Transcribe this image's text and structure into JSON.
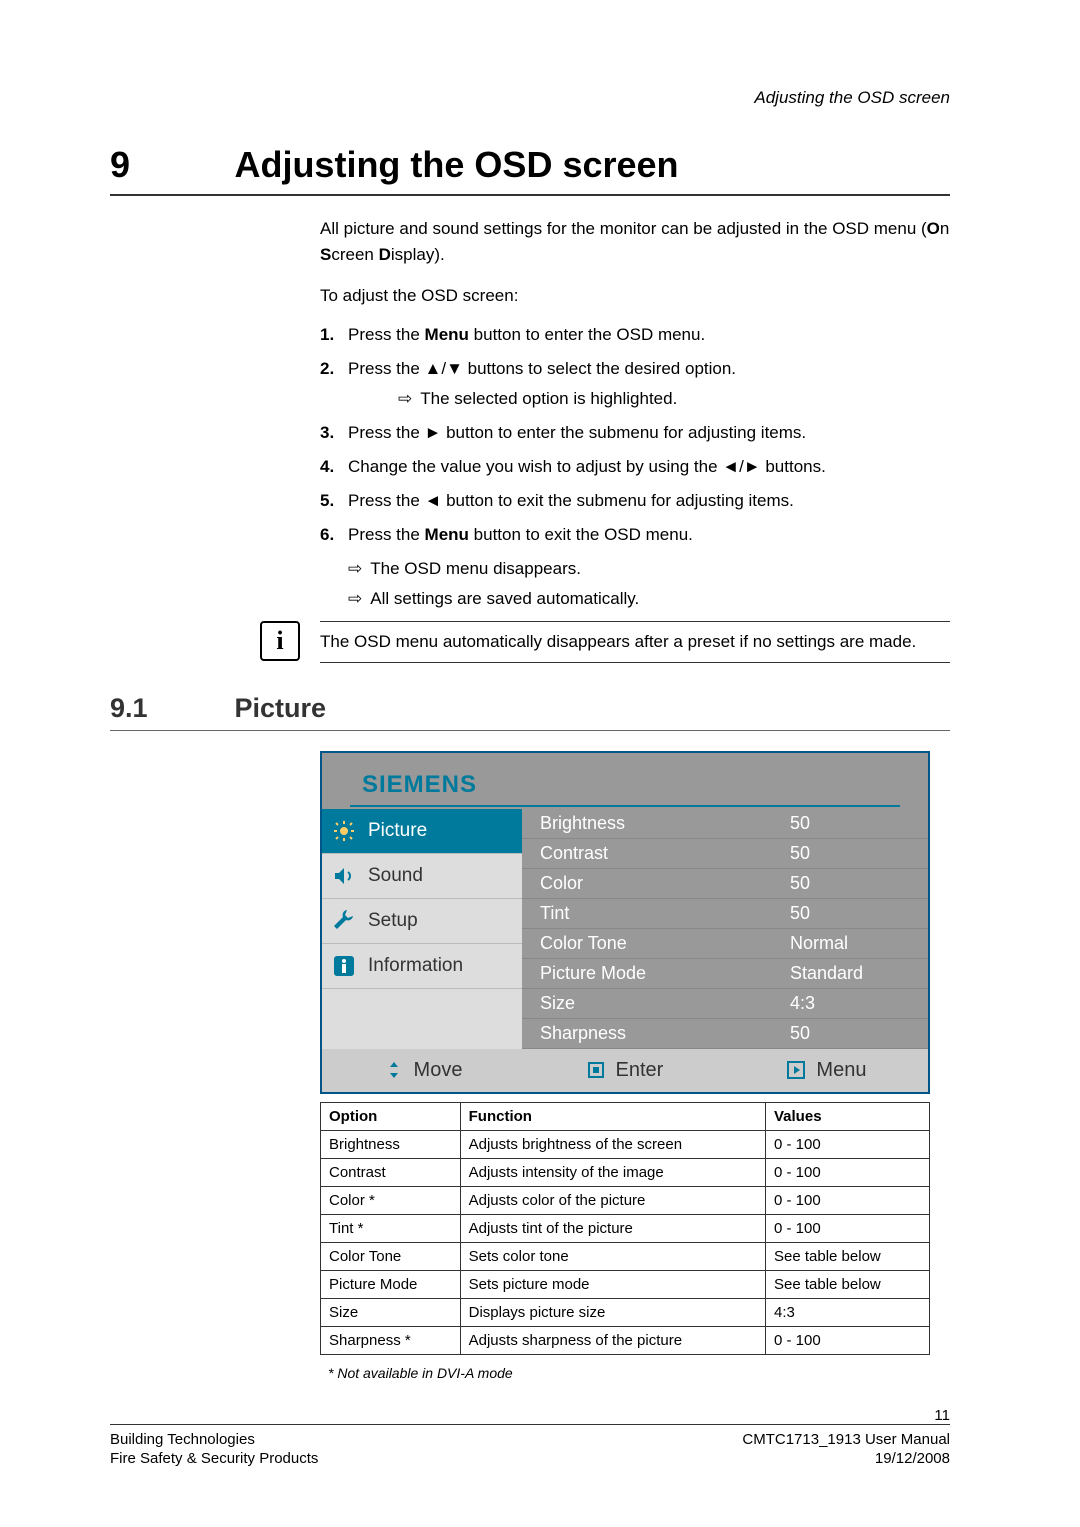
{
  "header_right": "Adjusting the OSD screen",
  "section": {
    "num": "9",
    "title": "Adjusting the OSD screen"
  },
  "intro1_a": "All picture and sound settings for the monitor can be adjusted in the OSD menu (",
  "intro1_b": "O",
  "intro1_c": "n ",
  "intro1_d": "S",
  "intro1_e": "creen ",
  "intro1_f": "D",
  "intro1_g": "isplay).",
  "intro2": "To adjust the OSD screen:",
  "steps": {
    "s1a": "Press the ",
    "s1b": "Menu",
    "s1c": " button to enter the OSD menu.",
    "s2": "Press the ▲/▼ buttons to select the desired option.",
    "s2r": "The selected option is highlighted.",
    "s3": "Press the ► button to enter the submenu for adjusting items.",
    "s4": "Change the value you wish to adjust by using the ◄/► buttons.",
    "s5": "Press the ◄ button to exit the submenu for adjusting items.",
    "s6a": "Press the ",
    "s6b": "Menu",
    "s6c": " button to exit the OSD menu."
  },
  "results": {
    "r1": "The OSD menu disappears.",
    "r2": "All settings are saved automatically."
  },
  "note": "The OSD menu automatically disappears after a preset if no settings are made.",
  "subsection": {
    "num": "9.1",
    "title": "Picture"
  },
  "osd": {
    "logo": "SIEMENS",
    "tabs": {
      "t1": "Picture",
      "t2": "Sound",
      "t3": "Setup",
      "t4": "Information"
    },
    "rows": [
      {
        "label": "Brightness",
        "val": "50"
      },
      {
        "label": "Contrast",
        "val": "50"
      },
      {
        "label": "Color",
        "val": "50"
      },
      {
        "label": "Tint",
        "val": "50"
      },
      {
        "label": "Color Tone",
        "val": "Normal"
      },
      {
        "label": "Picture Mode",
        "val": "Standard"
      },
      {
        "label": "Size",
        "val": " 4:3"
      },
      {
        "label": "Sharpness",
        "val": "50"
      }
    ],
    "footer": {
      "move": "Move",
      "enter": "Enter",
      "menu": "Menu"
    }
  },
  "table": {
    "headers": {
      "h1": "Option",
      "h2": "Function",
      "h3": "Values"
    },
    "rows": [
      {
        "c1": "Brightness",
        "c2": "Adjusts brightness of the screen",
        "c3": "0 - 100"
      },
      {
        "c1": "Contrast",
        "c2": "Adjusts intensity of the image",
        "c3": "0 - 100"
      },
      {
        "c1": "Color *",
        "c2": "Adjusts color of the picture",
        "c3": "0 - 100"
      },
      {
        "c1": "Tint *",
        "c2": "Adjusts tint of the picture",
        "c3": "0 - 100"
      },
      {
        "c1": "Color Tone",
        "c2": "Sets color tone",
        "c3": "See table below"
      },
      {
        "c1": "Picture Mode",
        "c2": "Sets picture mode",
        "c3": "See table below"
      },
      {
        "c1": "Size",
        "c2": "Displays picture size",
        "c3": "4:3"
      },
      {
        "c1": "Sharpness *",
        "c2": "Adjusts sharpness of the picture",
        "c3": "0 - 100"
      }
    ]
  },
  "footnote": "* Not available in DVI-A mode",
  "footer": {
    "page_num": "11",
    "left1": "Building Technologies",
    "left2": "Fire Safety & Security Products",
    "right1": "CMTC1713_1913 User Manual",
    "right2": "19/12/2008"
  }
}
